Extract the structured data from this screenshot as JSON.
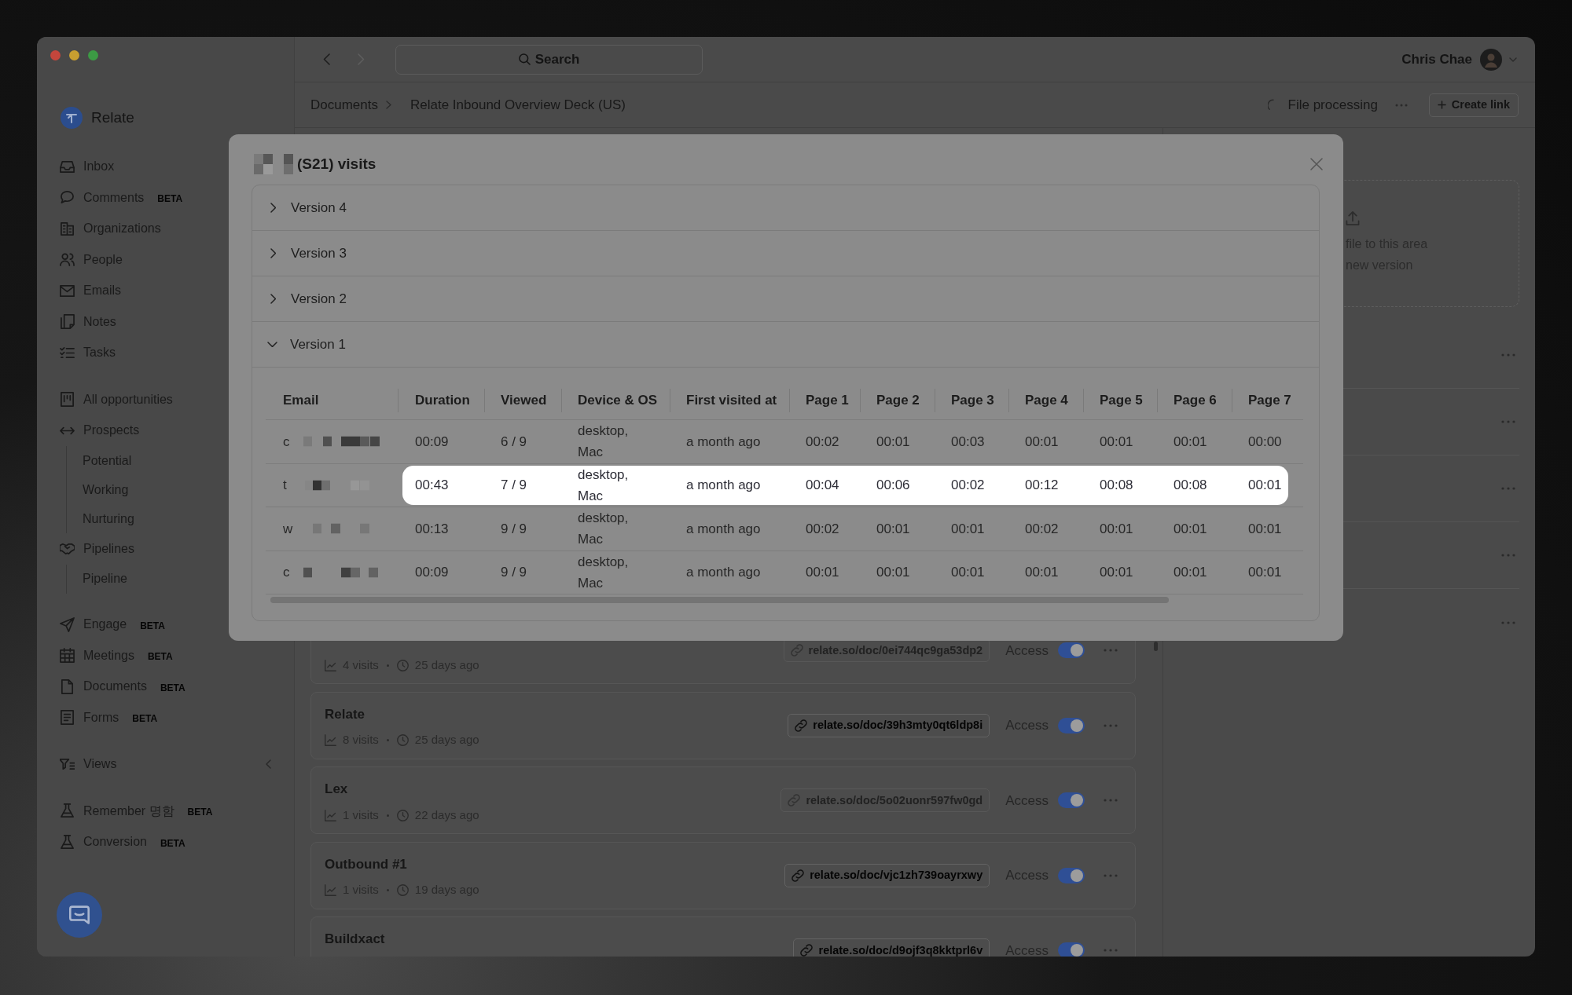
{
  "sidebar": {
    "brand": "Relate",
    "sections": [
      {
        "items": [
          {
            "label": "Inbox"
          },
          {
            "label": "Comments",
            "badge": "BETA"
          },
          {
            "label": "Organizations"
          },
          {
            "label": "People"
          },
          {
            "label": "Emails"
          },
          {
            "label": "Notes"
          },
          {
            "label": "Tasks"
          }
        ]
      },
      {
        "items": [
          {
            "label": "All opportunities"
          },
          {
            "label": "Prospects",
            "children": [
              {
                "label": "Potential"
              },
              {
                "label": "Working"
              },
              {
                "label": "Nurturing"
              }
            ]
          },
          {
            "label": "Pipelines",
            "children": [
              {
                "label": "Pipeline"
              }
            ]
          }
        ]
      },
      {
        "items": [
          {
            "label": "Engage",
            "badge": "BETA"
          },
          {
            "label": "Meetings",
            "badge": "BETA"
          },
          {
            "label": "Documents",
            "badge": "BETA"
          },
          {
            "label": "Forms",
            "badge": "BETA"
          }
        ]
      }
    ],
    "views": {
      "label": "Views",
      "expanded": false
    },
    "lab_items": [
      {
        "label": "Remember 명함",
        "badge": "BETA"
      },
      {
        "label": "Conversion",
        "badge": "BETA"
      }
    ]
  },
  "toolbar": {
    "nav_buttons": [
      {
        "kind": "back",
        "disabled": false
      },
      {
        "kind": "forward",
        "disabled": true
      }
    ],
    "search": {
      "label": "Search"
    },
    "user": {
      "name": "Chris Chae"
    }
  },
  "breadcrumb": [
    "Documents",
    "Relate Inbound Overview Deck (US)"
  ],
  "header_actions": {
    "status": "File processing",
    "create_link": "Create link"
  },
  "links": [
    {
      "visits": "4 visits",
      "age": "25 days ago",
      "url": "relate.so/doc/0ei744qc9ga53dp2",
      "disabled": true,
      "access_label": "Access",
      "access_on": true
    },
    {
      "title": "Relate",
      "visits": "8 visits",
      "age": "25 days ago",
      "url": "relate.so/doc/39h3mty0qt6ldp8i",
      "disabled": false,
      "access_label": "Access",
      "access_on": true
    },
    {
      "title": "Lex",
      "visits": "1 visits",
      "age": "22 days ago",
      "url": "relate.so/doc/5o02uonr597fw0gd",
      "disabled": true,
      "access_label": "Access",
      "access_on": true
    },
    {
      "title": "Outbound #1",
      "visits": "1 visits",
      "age": "19 days ago",
      "url": "relate.so/doc/vjc1zh739oayrxwy",
      "disabled": false,
      "access_label": "Access",
      "access_on": true
    },
    {
      "title": "Buildxact",
      "url": "relate.so/doc/d9ojf3q8kktprl6v",
      "disabled": false,
      "access_label": "Access",
      "access_on": true
    }
  ],
  "upload_panel": {
    "lines": [
      "file to this area",
      "new version"
    ]
  },
  "modal": {
    "title": "(S21) visits",
    "versions": [
      {
        "label": "Version 4",
        "expanded": false
      },
      {
        "label": "Version 3",
        "expanded": false
      },
      {
        "label": "Version 2",
        "expanded": false
      },
      {
        "label": "Version 1",
        "expanded": true,
        "table": {
          "columns": [
            "Email",
            "Duration",
            "Viewed",
            "Device & OS",
            "First visited at",
            "Page 1",
            "Page 2",
            "Page 3",
            "Page 4",
            "Page 5",
            "Page 6",
            "Page 7"
          ],
          "rows": [
            {
              "highlighted": false,
              "cells": [
                "c",
                "00:09",
                "6 / 9",
                "desktop, Mac",
                "a month ago",
                "00:02",
                "00:01",
                "00:03",
                "00:01",
                "00:01",
                "00:01",
                "00:00"
              ]
            },
            {
              "highlighted": true,
              "cells": [
                "t",
                "00:43",
                "7 / 9",
                "desktop, Mac",
                "a month ago",
                "00:04",
                "00:06",
                "00:02",
                "00:12",
                "00:08",
                "00:08",
                "00:01"
              ]
            },
            {
              "highlighted": false,
              "cells": [
                "w",
                "00:13",
                "9 / 9",
                "desktop, Mac",
                "a month ago",
                "00:02",
                "00:01",
                "00:01",
                "00:02",
                "00:01",
                "00:01",
                "00:01"
              ]
            },
            {
              "highlighted": false,
              "cells": [
                "c",
                "00:09",
                "9 / 9",
                "desktop, Mac",
                "a month ago",
                "00:01",
                "00:01",
                "00:01",
                "00:01",
                "00:01",
                "00:01",
                "00:01"
              ]
            }
          ]
        }
      }
    ]
  }
}
